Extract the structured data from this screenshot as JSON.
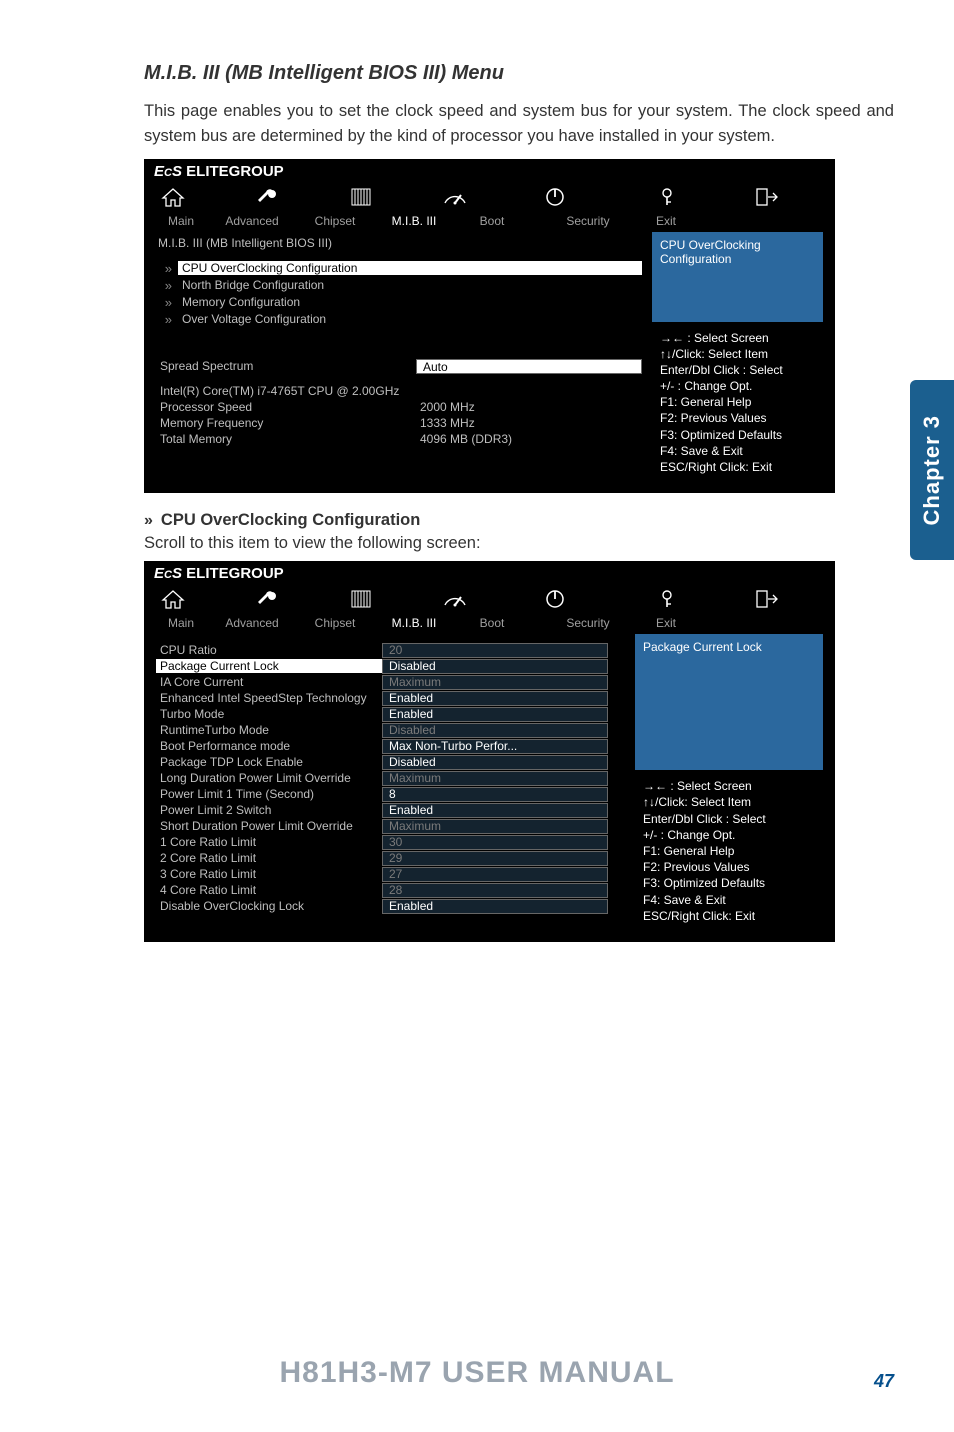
{
  "page": {
    "heading": "M.I.B. III (MB Intelligent BIOS III) Menu",
    "intro": "This page enables you to set the clock speed and system bus for your system. The clock speed and system bus are determined by the kind of processor you have installed in your system.",
    "subheading": "CPU OverClocking Configuration",
    "subtext": "Scroll to this item to view the following screen:",
    "footer": "H81H3-M7 USER MANUAL",
    "pagenum": "47",
    "chapter": "Chapter 3"
  },
  "bios": {
    "brand": "ELITEGROUP",
    "tabs": [
      "Main",
      "Advanced",
      "Chipset",
      "M.I.B. III",
      "Boot",
      "Security",
      "Exit"
    ]
  },
  "bios1": {
    "title": "M.I.B. III (MB Intelligent BIOS III)",
    "items": [
      "CPU OverClocking Configuration",
      "North Bridge Configuration",
      "Memory Configuration",
      "Over Voltage Configuration"
    ],
    "spread_label": "Spread Spectrum",
    "spread_value": "Auto",
    "info_lines": [
      {
        "label": "Intel(R) Core(TM) i7-4765T CPU @ 2.00GHz",
        "value": ""
      },
      {
        "label": "Processor Speed",
        "value": "2000 MHz"
      },
      {
        "label": "Memory Frequency",
        "value": "1333 MHz"
      },
      {
        "label": "Total Memory",
        "value": "4096 MB (DDR3)"
      }
    ],
    "help": "CPU OverClocking\nConfiguration",
    "hints": [
      "→←   : Select Screen",
      "↑↓/Click: Select Item",
      "Enter/Dbl Click : Select",
      "+/- : Change Opt.",
      "F1: General Help",
      "F2: Previous Values",
      "F3: Optimized Defaults",
      "F4: Save & Exit",
      "ESC/Right Click: Exit"
    ]
  },
  "bios2": {
    "help": "Package Current Lock",
    "settings": [
      {
        "label": "CPU Ratio",
        "value": "20",
        "grey": true
      },
      {
        "label": "Package Current Lock",
        "value": "Disabled",
        "highlight": true
      },
      {
        "label": "IA Core Current",
        "value": "Maximum",
        "grey": true
      },
      {
        "label": "Enhanced Intel SpeedStep Technology",
        "value": "Enabled"
      },
      {
        "label": "Turbo Mode",
        "value": "Enabled"
      },
      {
        "label": "RuntimeTurbo Mode",
        "value": "Disabled",
        "grey": true
      },
      {
        "label": "Boot Performance mode",
        "value": "Max Non-Turbo Perfor..."
      },
      {
        "label": "Package TDP Lock Enable",
        "value": "Disabled"
      },
      {
        "label": "Long Duration Power Limit Override",
        "value": "Maximum",
        "grey": true
      },
      {
        "label": "Power Limit 1 Time (Second)",
        "value": "8"
      },
      {
        "label": "Power Limit 2 Switch",
        "value": "Enabled"
      },
      {
        "label": "Short Duration Power Limit Override",
        "value": "Maximum",
        "grey": true
      },
      {
        "label": "1 Core Ratio Limit",
        "value": "30",
        "grey": true
      },
      {
        "label": "2 Core Ratio Limit",
        "value": "29",
        "grey": true
      },
      {
        "label": "3 Core Ratio Limit",
        "value": "27",
        "grey": true
      },
      {
        "label": "4 Core Ratio Limit",
        "value": "28",
        "grey": true
      },
      {
        "label": "Disable OverClocking Lock",
        "value": "Enabled"
      }
    ],
    "hints": [
      "→←   : Select Screen",
      "↑↓/Click: Select Item",
      "Enter/Dbl Click : Select",
      "+/- : Change Opt.",
      "F1: General Help",
      "F2: Previous Values",
      "F3: Optimized Defaults",
      "F4: Save & Exit",
      "ESC/Right Click: Exit"
    ]
  }
}
